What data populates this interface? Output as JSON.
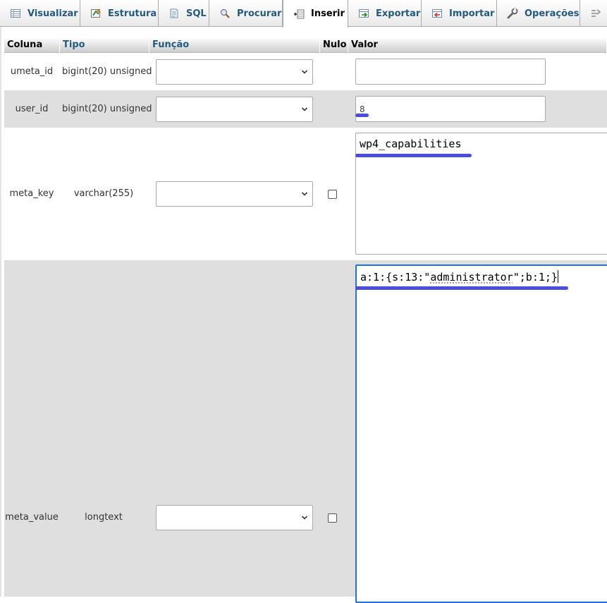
{
  "tabs": [
    {
      "label": "Visualizar",
      "icon": "browse-table-icon",
      "active": false
    },
    {
      "label": "Estrutura",
      "icon": "structure-icon",
      "active": false
    },
    {
      "label": "SQL",
      "icon": "sql-icon",
      "active": false
    },
    {
      "label": "Procurar",
      "icon": "search-icon",
      "active": false
    },
    {
      "label": "Inserir",
      "icon": "insert-icon",
      "active": true
    },
    {
      "label": "Exportar",
      "icon": "export-icon",
      "active": false
    },
    {
      "label": "Importar",
      "icon": "import-icon",
      "active": false
    },
    {
      "label": "Operações",
      "icon": "wrench-icon",
      "active": false
    }
  ],
  "table": {
    "headers": {
      "column": "Coluna",
      "type": "Tipo",
      "function": "Função",
      "null": "Nulo",
      "value": "Valor"
    },
    "rows": [
      {
        "column": "umeta_id",
        "type": "bigint(20) unsigned",
        "function": "",
        "value": "",
        "has_null_checkbox": false
      },
      {
        "column": "user_id",
        "type": "bigint(20) unsigned",
        "function": "",
        "value": "8",
        "has_null_checkbox": false
      },
      {
        "column": "meta_key",
        "type": "varchar(255)",
        "function": "",
        "value": "wp4_capabilities",
        "has_null_checkbox": true
      },
      {
        "column": "meta_value",
        "type": "longtext",
        "function": "",
        "value_parts": [
          "a:1:{s:13:\"",
          "administrator",
          "\";b:1;}"
        ],
        "has_null_checkbox": true
      }
    ]
  },
  "colors": {
    "link": "#235a81",
    "highlight": "#4a4ee0",
    "focus": "#1a73e8",
    "row_alt": "#dfdfdf"
  }
}
